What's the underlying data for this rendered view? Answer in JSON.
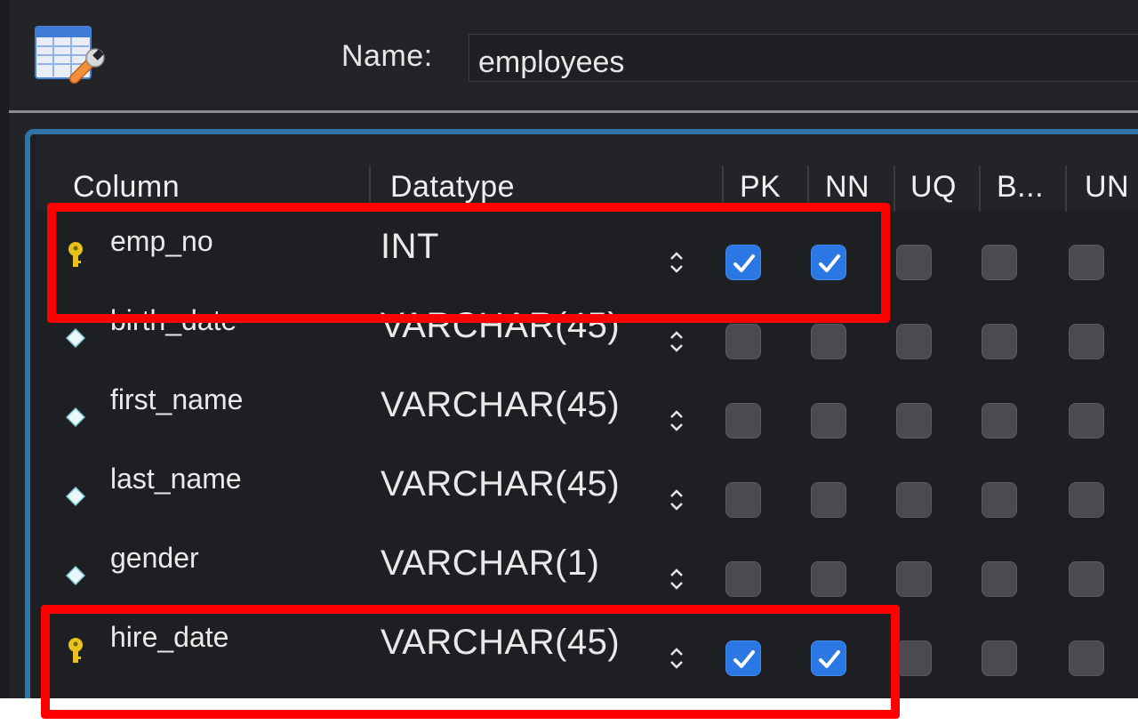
{
  "header": {
    "icon": "table-edit-wrench-icon",
    "name_label": "Name:",
    "name_value": "employees"
  },
  "table": {
    "columns": [
      "Column",
      "Datatype",
      "PK",
      "NN",
      "UQ",
      "B...",
      "UN"
    ],
    "rows": [
      {
        "name": "emp_no",
        "datatype": "INT",
        "icon": "key-icon",
        "pk": true,
        "nn": true,
        "uq": false,
        "b": false,
        "un": false
      },
      {
        "name": "birth_date",
        "datatype": "VARCHAR(45)",
        "icon": "diamond-icon",
        "pk": false,
        "nn": false,
        "uq": false,
        "b": false,
        "un": false
      },
      {
        "name": "first_name",
        "datatype": "VARCHAR(45)",
        "icon": "diamond-icon",
        "pk": false,
        "nn": false,
        "uq": false,
        "b": false,
        "un": false
      },
      {
        "name": "last_name",
        "datatype": "VARCHAR(45)",
        "icon": "diamond-icon",
        "pk": false,
        "nn": false,
        "uq": false,
        "b": false,
        "un": false
      },
      {
        "name": "gender",
        "datatype": "VARCHAR(1)",
        "icon": "diamond-icon",
        "pk": false,
        "nn": false,
        "uq": false,
        "b": false,
        "un": false
      },
      {
        "name": "hire_date",
        "datatype": "VARCHAR(45)",
        "icon": "key-icon",
        "pk": true,
        "nn": true,
        "uq": false,
        "b": false,
        "un": false
      }
    ]
  },
  "colors": {
    "window_bg": "#232427",
    "accent_frame": "#2f76a8",
    "checkbox_on": "#2b78e4",
    "checkbox_off": "#4a4b4f",
    "annotation_red": "#ff0000",
    "key_yellow": "#e8c21a"
  }
}
